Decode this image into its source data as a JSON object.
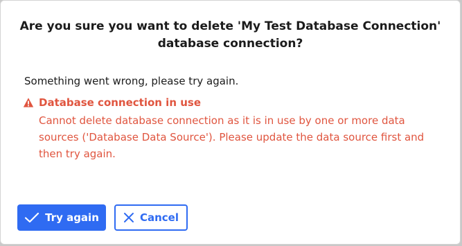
{
  "dialog": {
    "title_line1": "Are you sure you want to delete 'My Test Database Connection'",
    "title_line2": "database connection?",
    "message": "Something went wrong, please try again.",
    "error": {
      "title": "Database connection in use",
      "body": "Cannot delete database connection as it is in use by one or more data sources ('Database Data Source'). Please update the data source first and then try again.",
      "icon": "warning-icon"
    },
    "buttons": {
      "try_again": "Try again",
      "try_again_icon": "check-icon",
      "cancel": "Cancel",
      "cancel_icon": "close-icon"
    }
  },
  "colors": {
    "primary": "#2f6bf2",
    "error": "#e0553f",
    "text": "#1b1b1b",
    "backdrop": "#c9c9c9"
  }
}
